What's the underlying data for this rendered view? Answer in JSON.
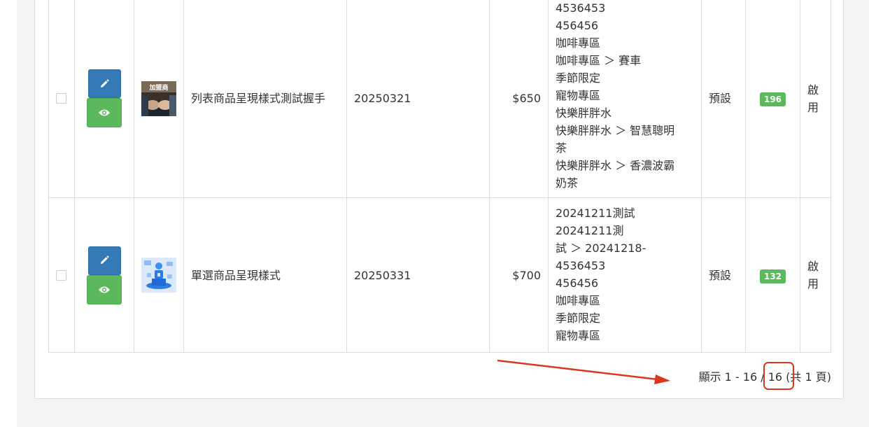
{
  "rows": [
    {
      "name": "列表商品呈現樣式測試握手",
      "code": "20250321",
      "price": "$650",
      "categories": [
        "4536453",
        "456456",
        "咖啡專區",
        "咖啡專區 ＞ 賽車",
        "季節限定",
        "寵物專區",
        "快樂胖胖水",
        "快樂胖胖水 ＞ 智慧聰明",
        "茶",
        "快樂胖胖水 ＞ 香濃波霸",
        "奶茶"
      ],
      "template": "預設",
      "count": "196",
      "status": "啟用",
      "thumb_text": "加盟商"
    },
    {
      "name": "單選商品呈現樣式",
      "code": "20250331",
      "price": "$700",
      "categories": [
        "20241211測試",
        "20241211測",
        "試 ＞ 20241218-",
        "4536453",
        "456456",
        "咖啡專區",
        "季節限定",
        "寵物專區"
      ],
      "template": "預設",
      "count": "132",
      "status": "啟用"
    }
  ],
  "pagination": {
    "prefix": "顯示 1 - 16 / ",
    "total": "16",
    "suffix": " (共 1 頁)"
  },
  "icons": {
    "edit": "pencil-icon",
    "view": "eye-icon"
  },
  "colors": {
    "primary": "#337ab7",
    "success": "#5cb85c",
    "annotation": "#d9381e"
  }
}
